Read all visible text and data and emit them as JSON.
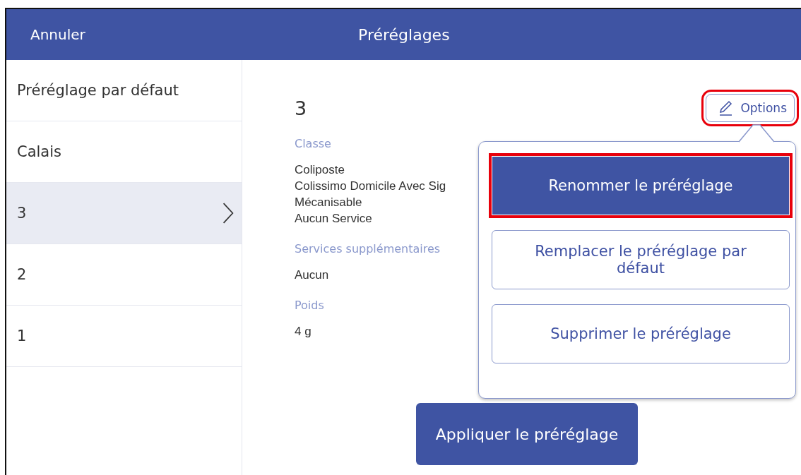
{
  "header": {
    "cancel": "Annuler",
    "title": "Préréglages"
  },
  "sidebar": {
    "items": [
      {
        "label": "Préréglage par défaut",
        "selected": false
      },
      {
        "label": "Calais",
        "selected": false
      },
      {
        "label": "3",
        "selected": true
      },
      {
        "label": "2",
        "selected": false
      },
      {
        "label": "1",
        "selected": false
      }
    ]
  },
  "detail": {
    "name": "3",
    "options_button": {
      "label": "Options",
      "highlighted": true
    },
    "sections": [
      {
        "label": "Classe",
        "lines": [
          "Coliposte",
          "Colissimo Domicile Avec Sig",
          "Mécanisable",
          "Aucun Service"
        ]
      },
      {
        "label": "Services supplémentaires",
        "lines": [
          "Aucun"
        ]
      },
      {
        "label": "Poids",
        "lines": [
          "4 g"
        ]
      }
    ],
    "apply_button": "Appliquer le préréglage"
  },
  "options_menu": {
    "items": [
      {
        "label": "Renommer le préréglage",
        "kind": "filled",
        "highlighted": true
      },
      {
        "label": "Remplacer le préréglage par défaut",
        "kind": "outlined",
        "highlighted": false
      },
      {
        "label": "Supprimer le préréglage",
        "kind": "outlined",
        "highlighted": false
      }
    ]
  }
}
